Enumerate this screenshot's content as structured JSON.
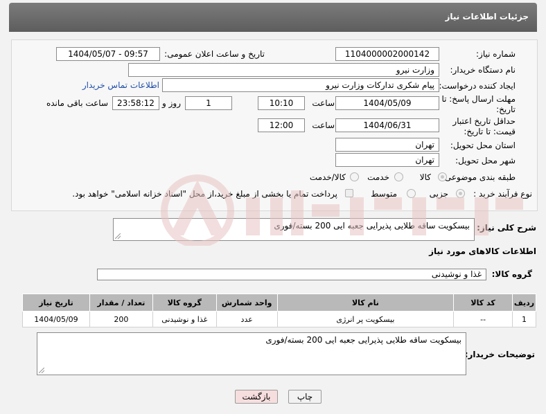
{
  "header": {
    "title": "جزئیات اطلاعات نیاز"
  },
  "fields": {
    "need_number_label": "شماره نیاز:",
    "need_number": "1104000002000142",
    "announce_label": "تاریخ و ساعت اعلان عمومی:",
    "announce_value": "1404/05/07 - 09:57",
    "buyer_org_label": "نام دستگاه خریدار:",
    "buyer_org": "وزارت نیرو",
    "creator_label": "ایجاد کننده درخواست:",
    "creator": "پیام شکری تدارکات وزارت نیرو",
    "buyer_contact_link": "اطلاعات تماس خریدار",
    "deadline_label": "مهلت ارسال پاسخ: تا تاریخ:",
    "deadline_date": "1404/05/09",
    "deadline_time_label": "ساعت",
    "deadline_time": "10:10",
    "days_value": "1",
    "days_label": "روز و",
    "remaining_time": "23:58:12",
    "remaining_label": "ساعت باقی مانده",
    "price_validity_label": "حداقل تاریخ اعتبار قیمت: تا تاریخ:",
    "price_validity_date": "1404/06/31",
    "price_validity_time_label": "ساعت",
    "price_validity_time": "12:00",
    "delivery_province_label": "استان محل تحویل:",
    "delivery_province": "تهران",
    "delivery_city_label": "شهر محل تحویل:",
    "delivery_city": "تهران",
    "category_label": "طبقه بندی موضوعی:",
    "category_options": [
      "کالا",
      "خدمت",
      "کالا/خدمت"
    ],
    "process_label": "نوع فرآیند خرید :",
    "process_options": [
      "جزیی",
      "متوسط"
    ],
    "payment_note": "پرداخت تمام یا بخشی از مبلغ خرید،از محل \"اسناد خزانه اسلامی\" خواهد بود.",
    "summary_label": "شرح کلی نیاز:",
    "summary_value": "بیسکویت ساقه طلایی پذیرایی جعبه ایی 200 بسته/فوری",
    "goods_info_title": "اطلاعات کالاهای مورد نیاز",
    "goods_group_label": "گروه کالا:",
    "goods_group_value": "غذا و نوشیدنی"
  },
  "table": {
    "headers": [
      "ردیف",
      "کد کالا",
      "نام کالا",
      "واحد شمارش",
      "گروه کالا",
      "تعداد / مقدار",
      "تاریخ نیاز"
    ],
    "rows": [
      [
        "1",
        "--",
        "بیسکویت پر انرژی",
        "عدد",
        "غذا و نوشیدنی",
        "200",
        "1404/05/09"
      ]
    ]
  },
  "buyer_notes": {
    "label": "توضیحات خریدار:",
    "value": "بیسکویت ساقه طلایی پذیرایی جعبه ایی 200 بسته/فوری"
  },
  "buttons": {
    "print": "چاپ",
    "back": "بازگشت"
  },
  "colors": {
    "header_bg": "#6b6b6b",
    "link": "#1f4ea8",
    "back_button_bg": "#f7dede",
    "table_header_bg": "#b9b9b9"
  }
}
